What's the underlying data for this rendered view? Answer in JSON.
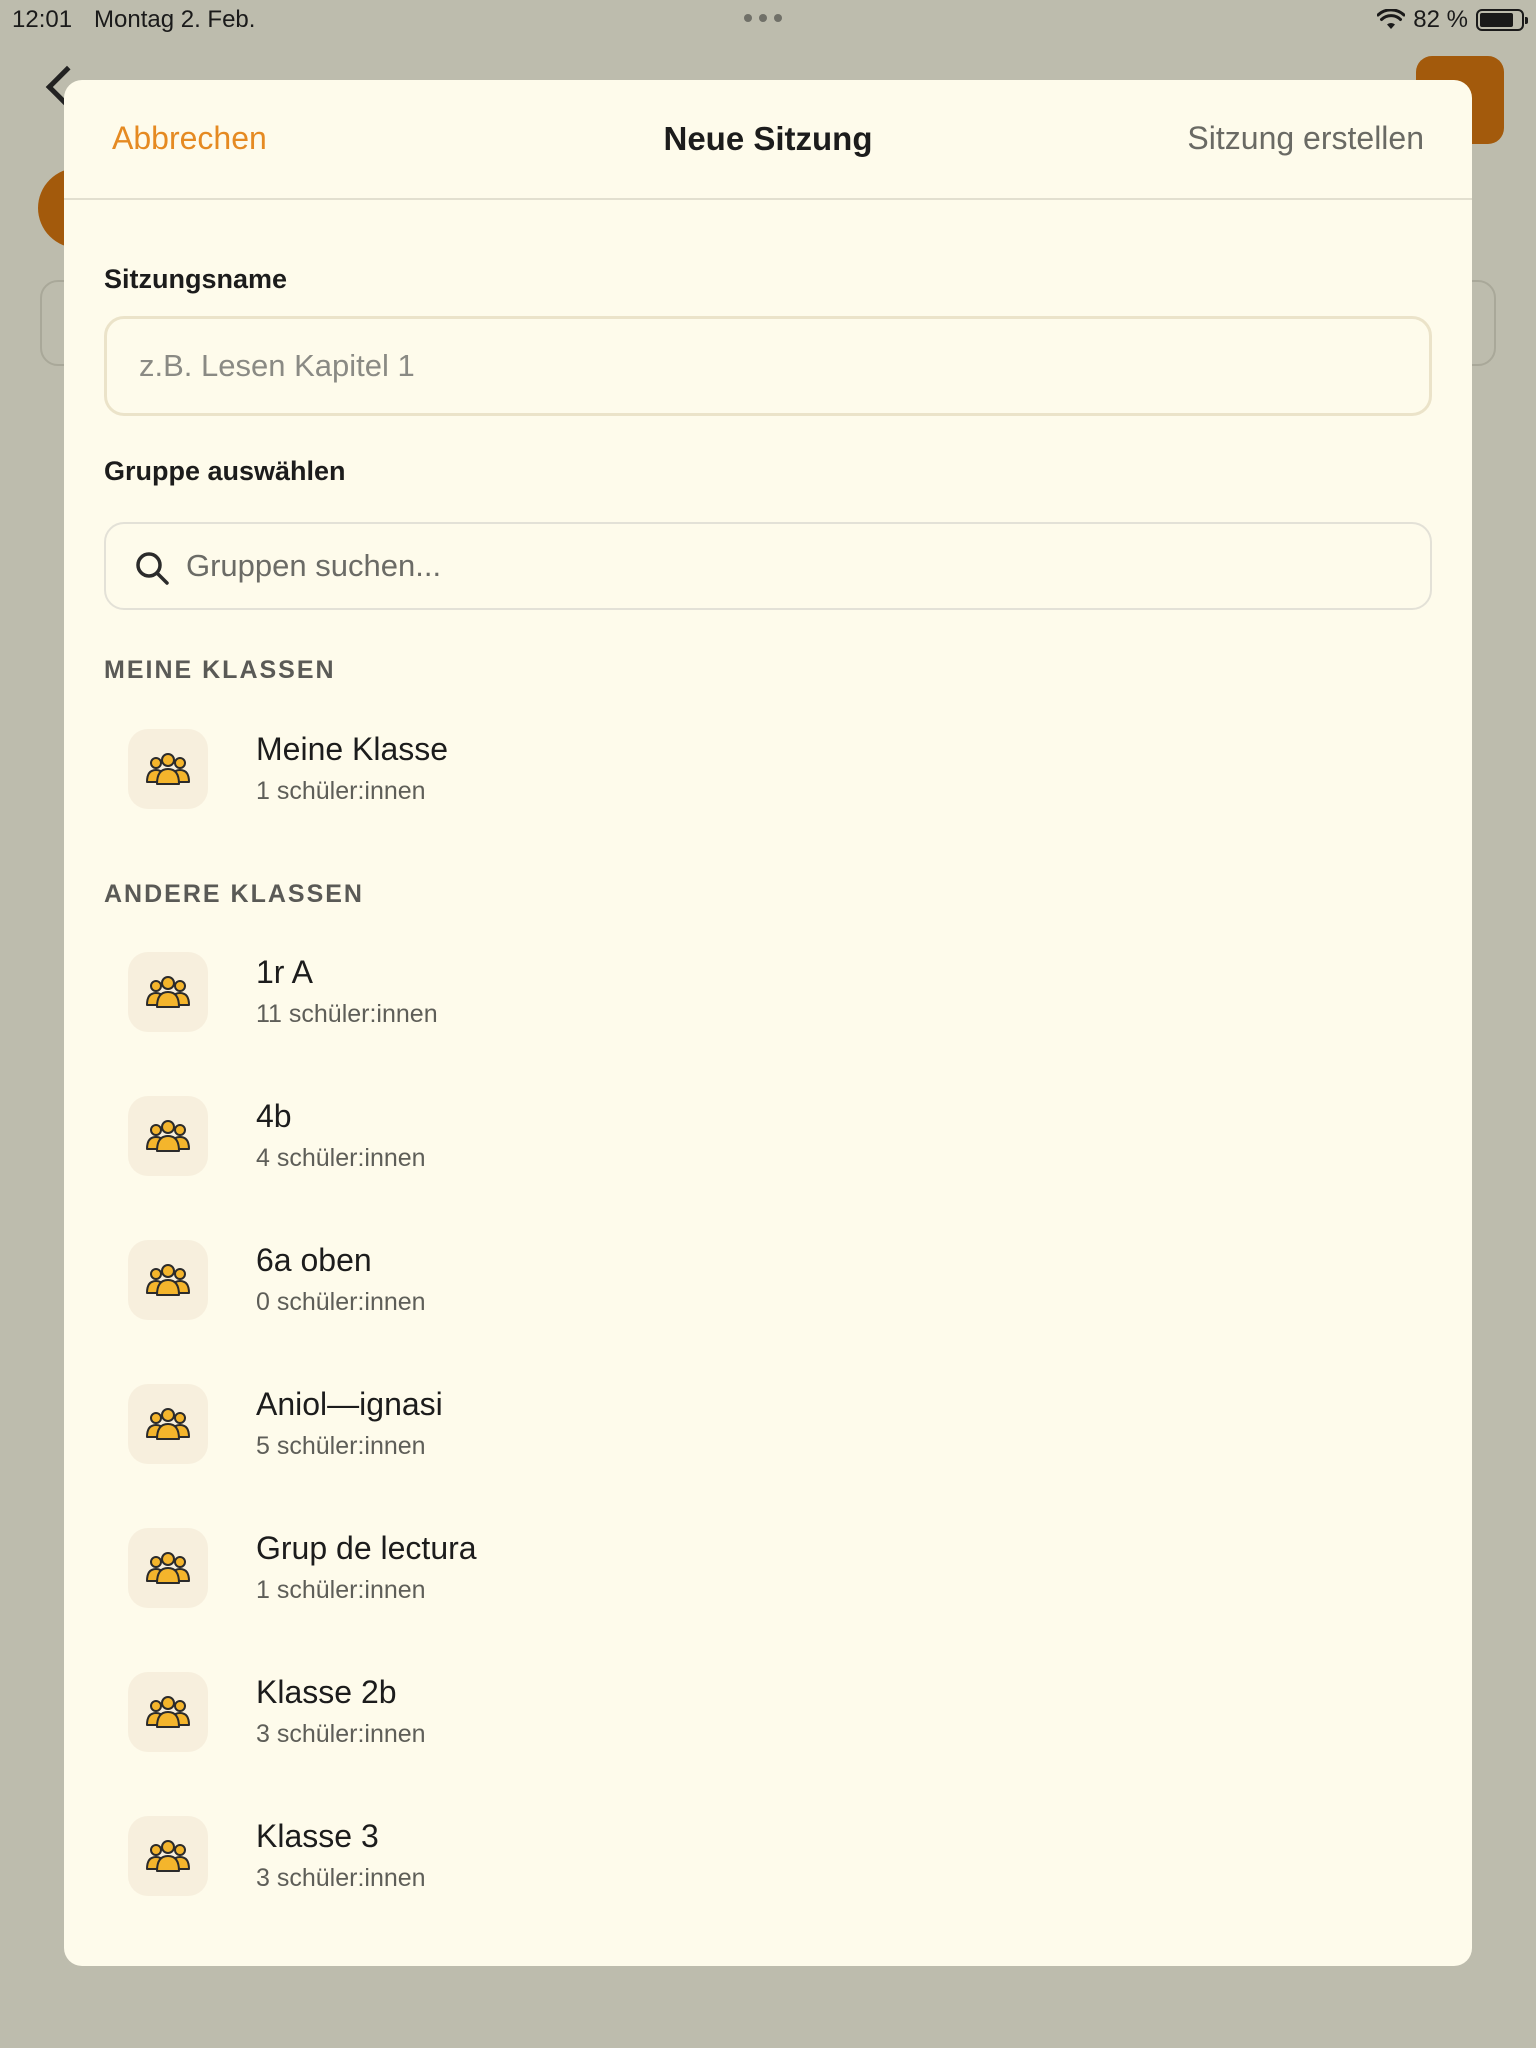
{
  "status_bar": {
    "time": "12:01",
    "date": "Montag 2. Feb.",
    "battery_percent_label": "82 %",
    "battery_level": 0.82
  },
  "modal": {
    "cancel_label": "Abbrechen",
    "title": "Neue Sitzung",
    "create_label": "Sitzung erstellen",
    "session_name_label": "Sitzungsname",
    "session_name_placeholder": "z.B. Lesen Kapitel 1",
    "session_name_value": "",
    "group_label": "Gruppe auswählen",
    "search_placeholder": "Gruppen suchen...",
    "my_classes_heading": "MEINE KLASSEN",
    "my_classes": [
      {
        "name": "Meine Klasse",
        "count": "1 schüler:innen"
      }
    ],
    "other_classes_heading": "ANDERE KLASSEN",
    "other_classes": [
      {
        "name": "1r A",
        "count": "11 schüler:innen"
      },
      {
        "name": "4b",
        "count": "4 schüler:innen"
      },
      {
        "name": "6a oben",
        "count": "0 schüler:innen"
      },
      {
        "name": "Aniol—ignasi",
        "count": "5 schüler:innen"
      },
      {
        "name": "Grup de lectura",
        "count": "1 schüler:innen"
      },
      {
        "name": "Klasse 2b",
        "count": "3 schüler:innen"
      },
      {
        "name": "Klasse 3",
        "count": "3 schüler:innen"
      }
    ]
  },
  "colors": {
    "accent": "#e58a22",
    "modal_background": "#fefbeb",
    "icon_background": "#f7efdd",
    "group_icon_fill": "#f4b52c",
    "backdrop": "#bdbcad"
  },
  "icons": {
    "group": "people-group-icon",
    "search": "search-icon",
    "wifi": "wifi-icon",
    "battery": "battery-icon"
  }
}
